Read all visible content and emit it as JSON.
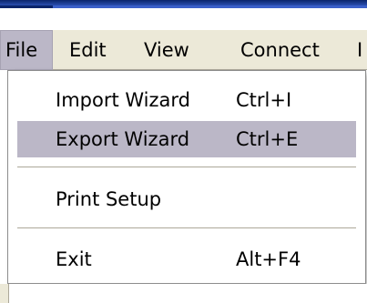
{
  "menubar": {
    "items": [
      {
        "label": "File",
        "active": true
      },
      {
        "label": "Edit",
        "active": false
      },
      {
        "label": "View",
        "active": false
      },
      {
        "label": "Connect",
        "active": false
      },
      {
        "label": "I",
        "active": false
      }
    ]
  },
  "file_menu": {
    "items": [
      {
        "label": "Import Wizard",
        "shortcut": "Ctrl+I",
        "highlighted": false
      },
      {
        "label": "Export Wizard",
        "shortcut": "Ctrl+E",
        "highlighted": true
      },
      {
        "label": "Print Setup",
        "shortcut": "",
        "highlighted": false
      },
      {
        "label": "Exit",
        "shortcut": "Alt+F4",
        "highlighted": false
      }
    ]
  },
  "colors": {
    "menubar_bg": "#ece9d8",
    "highlight": "#bbb7c7",
    "title_blue": "#0a246a"
  }
}
